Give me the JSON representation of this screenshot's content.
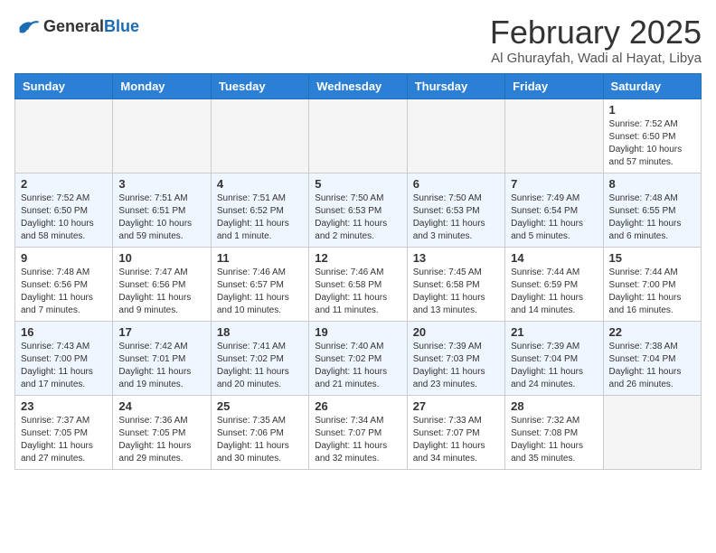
{
  "header": {
    "logo_general": "General",
    "logo_blue": "Blue",
    "month_title": "February 2025",
    "location": "Al Ghurayfah, Wadi al Hayat, Libya"
  },
  "weekdays": [
    "Sunday",
    "Monday",
    "Tuesday",
    "Wednesday",
    "Thursday",
    "Friday",
    "Saturday"
  ],
  "weeks": [
    [
      {
        "day": "",
        "info": ""
      },
      {
        "day": "",
        "info": ""
      },
      {
        "day": "",
        "info": ""
      },
      {
        "day": "",
        "info": ""
      },
      {
        "day": "",
        "info": ""
      },
      {
        "day": "",
        "info": ""
      },
      {
        "day": "1",
        "info": "Sunrise: 7:52 AM\nSunset: 6:50 PM\nDaylight: 10 hours and 57 minutes."
      }
    ],
    [
      {
        "day": "2",
        "info": "Sunrise: 7:52 AM\nSunset: 6:50 PM\nDaylight: 10 hours and 58 minutes."
      },
      {
        "day": "3",
        "info": "Sunrise: 7:51 AM\nSunset: 6:51 PM\nDaylight: 10 hours and 59 minutes."
      },
      {
        "day": "4",
        "info": "Sunrise: 7:51 AM\nSunset: 6:52 PM\nDaylight: 11 hours and 1 minute."
      },
      {
        "day": "5",
        "info": "Sunrise: 7:50 AM\nSunset: 6:53 PM\nDaylight: 11 hours and 2 minutes."
      },
      {
        "day": "6",
        "info": "Sunrise: 7:50 AM\nSunset: 6:53 PM\nDaylight: 11 hours and 3 minutes."
      },
      {
        "day": "7",
        "info": "Sunrise: 7:49 AM\nSunset: 6:54 PM\nDaylight: 11 hours and 5 minutes."
      },
      {
        "day": "8",
        "info": "Sunrise: 7:48 AM\nSunset: 6:55 PM\nDaylight: 11 hours and 6 minutes."
      }
    ],
    [
      {
        "day": "9",
        "info": "Sunrise: 7:48 AM\nSunset: 6:56 PM\nDaylight: 11 hours and 7 minutes."
      },
      {
        "day": "10",
        "info": "Sunrise: 7:47 AM\nSunset: 6:56 PM\nDaylight: 11 hours and 9 minutes."
      },
      {
        "day": "11",
        "info": "Sunrise: 7:46 AM\nSunset: 6:57 PM\nDaylight: 11 hours and 10 minutes."
      },
      {
        "day": "12",
        "info": "Sunrise: 7:46 AM\nSunset: 6:58 PM\nDaylight: 11 hours and 11 minutes."
      },
      {
        "day": "13",
        "info": "Sunrise: 7:45 AM\nSunset: 6:58 PM\nDaylight: 11 hours and 13 minutes."
      },
      {
        "day": "14",
        "info": "Sunrise: 7:44 AM\nSunset: 6:59 PM\nDaylight: 11 hours and 14 minutes."
      },
      {
        "day": "15",
        "info": "Sunrise: 7:44 AM\nSunset: 7:00 PM\nDaylight: 11 hours and 16 minutes."
      }
    ],
    [
      {
        "day": "16",
        "info": "Sunrise: 7:43 AM\nSunset: 7:00 PM\nDaylight: 11 hours and 17 minutes."
      },
      {
        "day": "17",
        "info": "Sunrise: 7:42 AM\nSunset: 7:01 PM\nDaylight: 11 hours and 19 minutes."
      },
      {
        "day": "18",
        "info": "Sunrise: 7:41 AM\nSunset: 7:02 PM\nDaylight: 11 hours and 20 minutes."
      },
      {
        "day": "19",
        "info": "Sunrise: 7:40 AM\nSunset: 7:02 PM\nDaylight: 11 hours and 21 minutes."
      },
      {
        "day": "20",
        "info": "Sunrise: 7:39 AM\nSunset: 7:03 PM\nDaylight: 11 hours and 23 minutes."
      },
      {
        "day": "21",
        "info": "Sunrise: 7:39 AM\nSunset: 7:04 PM\nDaylight: 11 hours and 24 minutes."
      },
      {
        "day": "22",
        "info": "Sunrise: 7:38 AM\nSunset: 7:04 PM\nDaylight: 11 hours and 26 minutes."
      }
    ],
    [
      {
        "day": "23",
        "info": "Sunrise: 7:37 AM\nSunset: 7:05 PM\nDaylight: 11 hours and 27 minutes."
      },
      {
        "day": "24",
        "info": "Sunrise: 7:36 AM\nSunset: 7:05 PM\nDaylight: 11 hours and 29 minutes."
      },
      {
        "day": "25",
        "info": "Sunrise: 7:35 AM\nSunset: 7:06 PM\nDaylight: 11 hours and 30 minutes."
      },
      {
        "day": "26",
        "info": "Sunrise: 7:34 AM\nSunset: 7:07 PM\nDaylight: 11 hours and 32 minutes."
      },
      {
        "day": "27",
        "info": "Sunrise: 7:33 AM\nSunset: 7:07 PM\nDaylight: 11 hours and 34 minutes."
      },
      {
        "day": "28",
        "info": "Sunrise: 7:32 AM\nSunset: 7:08 PM\nDaylight: 11 hours and 35 minutes."
      },
      {
        "day": "",
        "info": ""
      }
    ]
  ]
}
